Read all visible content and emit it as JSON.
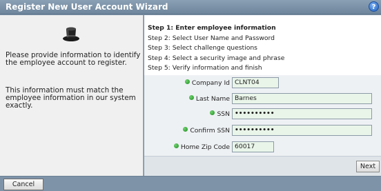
{
  "wizard": {
    "title": "Register New User Account Wizard",
    "help_icon": "help-icon"
  },
  "left_panel": {
    "icon": "hat-icon",
    "paragraph_1": "Please provide information to identify the employee account to register.",
    "paragraph_2": "This information must match the employee information in our system exactly."
  },
  "steps": [
    {
      "label": "Step 1: Enter employee information",
      "active": true
    },
    {
      "label": "Step 2: Select User Name and Password",
      "active": false
    },
    {
      "label": "Step 3: Select challenge questions",
      "active": false
    },
    {
      "label": "Step 4: Select a security image and phrase",
      "active": false
    },
    {
      "label": "Step 5: Verify information and finish",
      "active": false
    }
  ],
  "form": {
    "company_id": {
      "label": "Company Id",
      "value": "CLNT04"
    },
    "last_name": {
      "label": "Last Name",
      "value": "Barnes"
    },
    "ssn": {
      "label": "SSN",
      "value": "••••••••••"
    },
    "confirm_ssn": {
      "label": "Confirm SSN",
      "value": "••••••••••"
    },
    "home_zip": {
      "label": "Home Zip Code",
      "value": "60017"
    }
  },
  "buttons": {
    "next": "Next",
    "cancel": "Cancel"
  },
  "colors": {
    "title_bar": "#7e93a8",
    "field_background": "#e9f5e9",
    "required_bullet": "#2aa02a"
  }
}
